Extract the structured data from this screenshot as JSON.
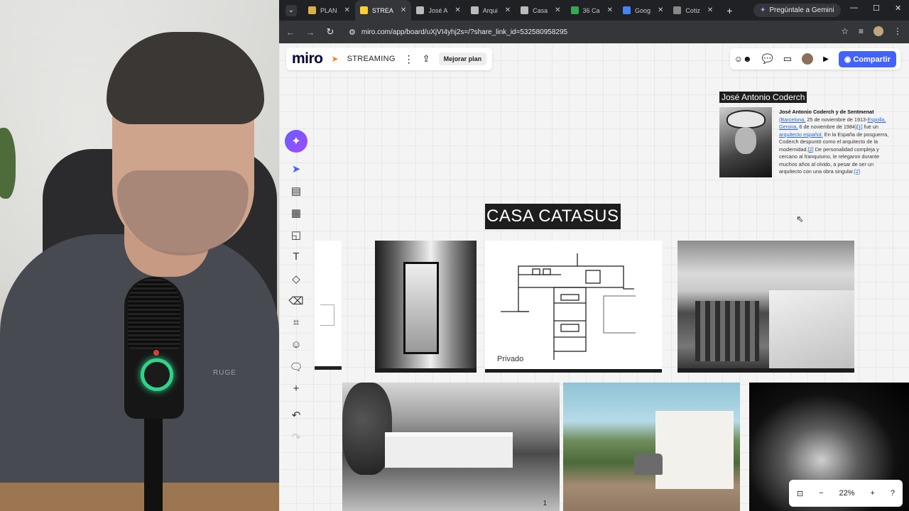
{
  "tabs": [
    {
      "title": "PLAN",
      "color": "#d9b04a"
    },
    {
      "title": "STREA",
      "color": "#ffd02f",
      "active": true
    },
    {
      "title": "José A",
      "color": "#bbbbbb"
    },
    {
      "title": "Arqui",
      "color": "#bbbbbb"
    },
    {
      "title": "Casa",
      "color": "#bbbbbb"
    },
    {
      "title": "36 Ca",
      "color": "#34a853"
    },
    {
      "title": "Goog",
      "color": "#4285f4"
    },
    {
      "title": "Cotiz",
      "color": "#888888"
    }
  ],
  "gemini_label": "Pregúntale a Gemini",
  "url": "miro.com/app/board/uXjVI4yhj2s=/?share_link_id=532580958295",
  "miro": {
    "logo": "miro",
    "board_name": "STREAMING",
    "upgrade_label": "Mejorar plan",
    "share_label": "Compartir",
    "zoom": "22%"
  },
  "board": {
    "person_title": "José Antonio Coderch",
    "bio_name": "José Antonio Coderch y de Sentmenat",
    "bio_link1": "(Barcelona,",
    "bio_text1": "25 de noviembre de 1913-",
    "bio_link2": "Espolla, Gerona,",
    "bio_text2": "6 de noviembre de 1984)",
    "bio_link3": "[1]",
    "bio_text3": "fue un",
    "bio_link4": "arquitecto español.",
    "bio_text4": "En la España de posguerra, Coderch despuntó como el arquitecto de la modernidad.",
    "bio_link5": "[2]",
    "bio_text5": "De personalidad compleja y cercano al franquismo, le relegaron durante muchos años al olvido, a pesar de ser un arquitecto con una obra singular.",
    "bio_link6": "[2]",
    "casa_title": "CASA CATASUS",
    "plan_label": "Privado",
    "photo_page_number": "1"
  },
  "webcam": {
    "shirt_logo": "RUGE"
  }
}
